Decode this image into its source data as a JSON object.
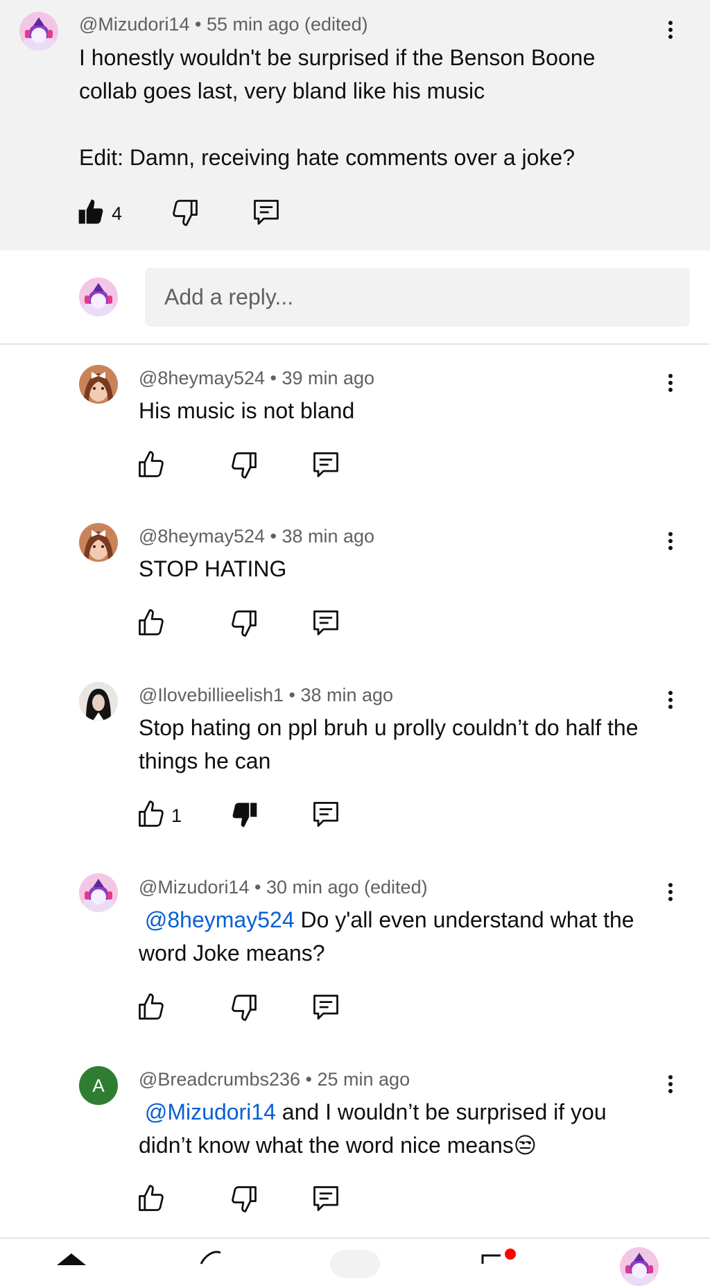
{
  "parent": {
    "author": "@Mizudori14",
    "time": "55 min ago (edited)",
    "text_line1": "I honestly wouldn't be surprised if the Benson Boone",
    "text_line2": "collab goes last, very bland like his music",
    "edit_line": "Edit: Damn, receiving hate comments over a joke?",
    "likes": "4"
  },
  "reply_box": {
    "placeholder": "Add a reply..."
  },
  "replies": [
    {
      "author": "@8heymay524",
      "time": "39 min ago",
      "line1": "His music is not bland"
    },
    {
      "author": "@8heymay524",
      "time": "38 min ago",
      "line1": "STOP HATING"
    },
    {
      "author": "@Ilovebillieelish1",
      "time": "38 min ago",
      "line1": "Stop hating on ppl bruh u prolly couldn’t do half the",
      "line2": "things he can",
      "likes": "1"
    },
    {
      "author": "@Mizudori14",
      "time": "30 min ago (edited)",
      "mention": "@8heymay524",
      "line1_rest": " Do y'all even understand what the",
      "line2": "word Joke means?"
    },
    {
      "author": "@Breadcrumbs236",
      "time": "25 min ago",
      "avatar_letter": "A",
      "mention": "@Mizudori14",
      "line1_rest": " and I wouldn’t be surprised if you",
      "line2": "didn’t know what the word nice means😒"
    }
  ],
  "sep": " • ",
  "colors": {
    "mention": "#065fd4",
    "parent_bg": "#f2f2f2",
    "avatar_green": "#2e7d32",
    "notification_dot": "#ff0000"
  }
}
